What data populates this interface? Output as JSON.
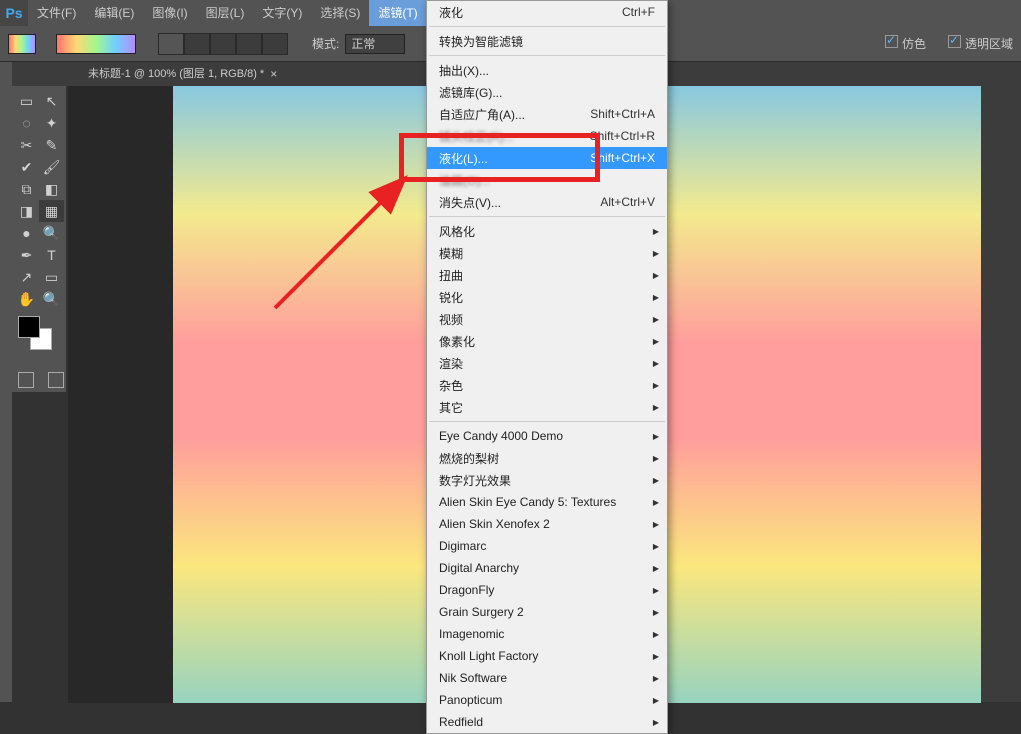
{
  "menubar": {
    "logo": "Ps",
    "items": [
      "文件(F)",
      "编辑(E)",
      "图像(I)",
      "图层(L)",
      "文字(Y)",
      "选择(S)",
      "滤镜(T)"
    ],
    "active_index": 6
  },
  "options_bar": {
    "mode_label": "模式:",
    "mode_value": "正常",
    "opt1": "仿色",
    "opt2": "透明区域"
  },
  "document_tab": {
    "title": "未标题-1 @ 100% (图层 1, RGB/8) *",
    "close": "×"
  },
  "filter_menu": {
    "group1": [
      {
        "label": "液化",
        "shortcut": "Ctrl+F"
      }
    ],
    "group2": [
      {
        "label": "转换为智能滤镜",
        "shortcut": ""
      }
    ],
    "group3": [
      {
        "label": "抽出(X)...",
        "shortcut": ""
      },
      {
        "label": "滤镜库(G)...",
        "shortcut": ""
      },
      {
        "label": "自适应广角(A)...",
        "shortcut": "Shift+Ctrl+A"
      },
      {
        "label": "镜头校正(R)...",
        "shortcut": "Shift+Ctrl+R",
        "obscured": true
      },
      {
        "label": "液化(L)...",
        "shortcut": "Shift+Ctrl+X",
        "highlight": true
      },
      {
        "label": "油画(O)...",
        "shortcut": "",
        "obscured": true
      },
      {
        "label": "消失点(V)...",
        "shortcut": "Alt+Ctrl+V"
      }
    ],
    "group4": [
      {
        "label": "风格化",
        "sub": true
      },
      {
        "label": "模糊",
        "sub": true
      },
      {
        "label": "扭曲",
        "sub": true
      },
      {
        "label": "锐化",
        "sub": true
      },
      {
        "label": "视频",
        "sub": true
      },
      {
        "label": "像素化",
        "sub": true
      },
      {
        "label": "渲染",
        "sub": true
      },
      {
        "label": "杂色",
        "sub": true
      },
      {
        "label": "其它",
        "sub": true
      }
    ],
    "group5": [
      {
        "label": "Eye Candy 4000 Demo",
        "sub": true
      },
      {
        "label": "燃烧的梨树",
        "sub": true
      },
      {
        "label": "数字灯光效果",
        "sub": true
      },
      {
        "label": "Alien Skin Eye Candy 5: Textures",
        "sub": true
      },
      {
        "label": "Alien Skin Xenofex 2",
        "sub": true
      },
      {
        "label": "Digimarc",
        "sub": true
      },
      {
        "label": "Digital Anarchy",
        "sub": true
      },
      {
        "label": "DragonFly",
        "sub": true
      },
      {
        "label": "Grain Surgery 2",
        "sub": true
      },
      {
        "label": "Imagenomic",
        "sub": true
      },
      {
        "label": "Knoll Light Factory",
        "sub": true
      },
      {
        "label": "Nik Software",
        "sub": true
      },
      {
        "label": "Panopticum",
        "sub": true
      },
      {
        "label": "Redfield",
        "sub": true
      }
    ]
  },
  "tools": [
    [
      "▭",
      "↖"
    ],
    [
      "◌",
      "✦"
    ],
    [
      "✂",
      "✎"
    ],
    [
      "✔",
      "🖌"
    ],
    [
      "⧉",
      "◧"
    ],
    [
      "◨",
      "▦"
    ],
    [
      "●",
      "🔍"
    ],
    [
      "✒",
      "T"
    ],
    [
      "↗",
      "▭"
    ],
    [
      "✋",
      "🔍"
    ]
  ]
}
